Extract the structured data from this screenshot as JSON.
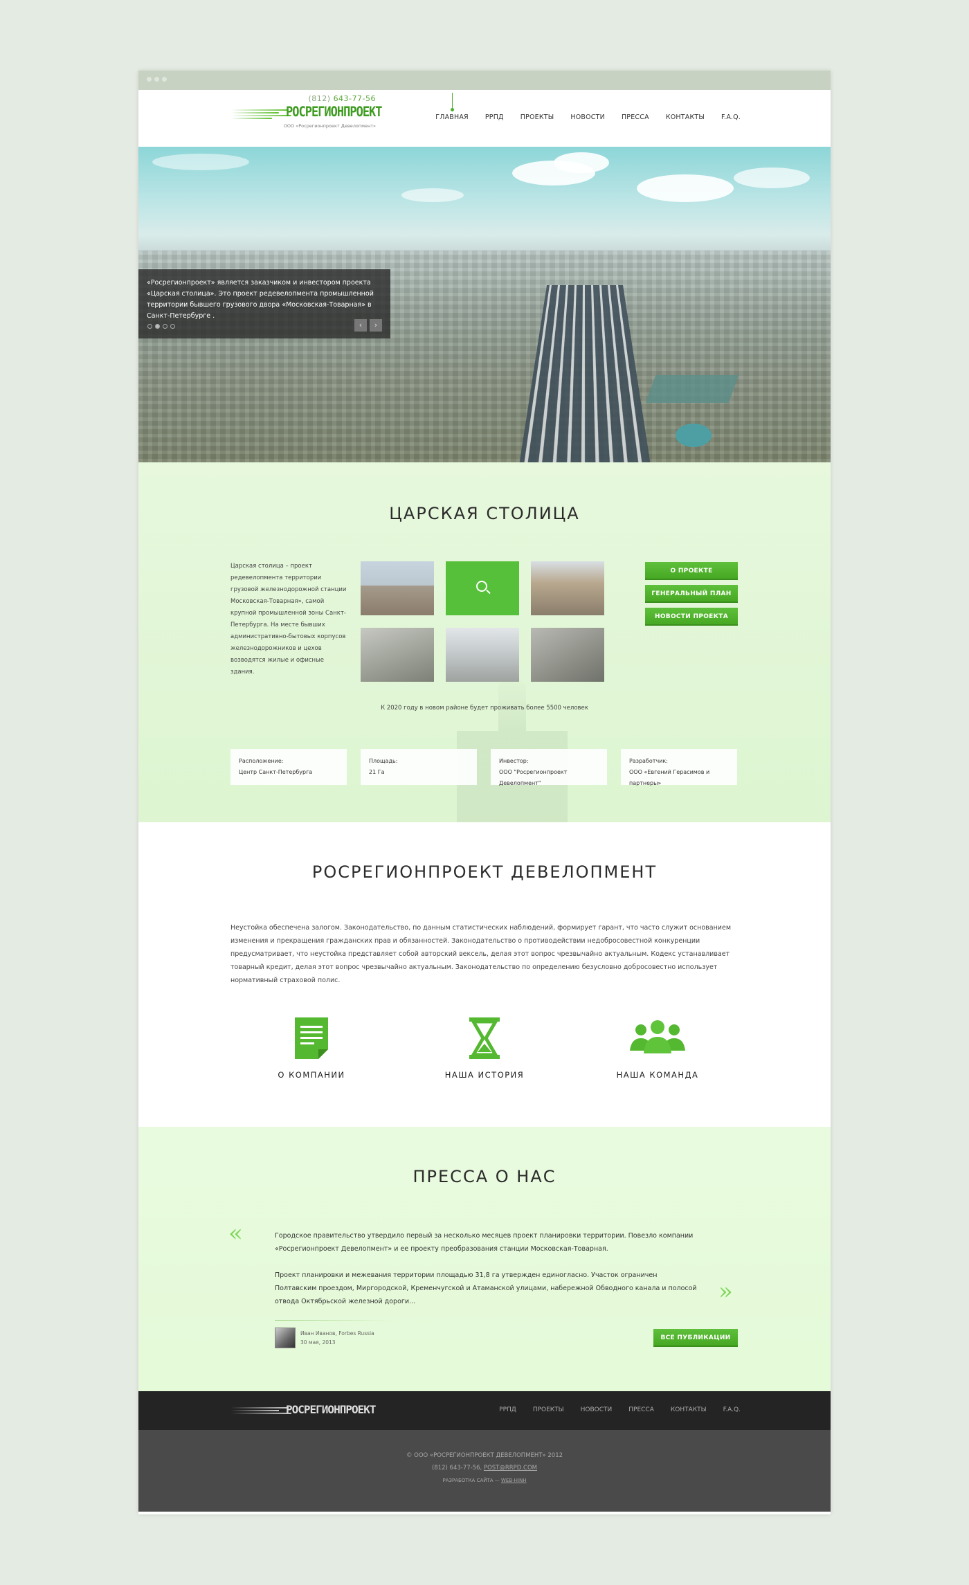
{
  "header": {
    "phone_prefix": "(812)",
    "phone": "643-77-56",
    "brand": "РОСРЕГИОНПРОЕКТ",
    "sub": "ООО «Росрегионпроект Девелопмент»",
    "nav": [
      "ГЛАВНАЯ",
      "РРПД",
      "ПРОЕКТЫ",
      "НОВОСТИ",
      "ПРЕССА",
      "КОНТАКТЫ",
      "F.A.Q."
    ]
  },
  "hero": {
    "caption": "«Росрегионпроект» является заказчиком и инвестором проекта «Царская столица». Это проект редевелопмента промышленной территории бывшего грузового двора «Московская-Товарная» в Санкт-Петербурге .",
    "prev": "‹",
    "next": "›"
  },
  "project": {
    "title": "ЦАРСКАЯ СТОЛИЦА",
    "text": "Царская столица – проект редевелопмента территории грузовой железнодорожной станции Московская-Товарная», самой крупной промышленной зоны Санкт-Петербурга. На месте бывших административно-бытовых корпусов железнодорожников и цехов возводятся жилые и офисные здания.",
    "buttons": [
      "О ПРОЕКТЕ",
      "ГЕНЕРАЛЬНЫЙ ПЛАН",
      "НОВОСТИ ПРОЕКТА"
    ],
    "note": "К 2020 году в новом районе будет проживать более 5500 человек",
    "info": [
      {
        "label": "Расположение:",
        "value": "Центр Санкт-Петербурга"
      },
      {
        "label": "Площадь:",
        "value": "21 Га"
      },
      {
        "label": "Инвестор:",
        "value": "ООО \"Росрегионпроект Девелопмент\""
      },
      {
        "label": "Разработчик:",
        "value": "ООО «Евгений Герасимов и партнеры»"
      }
    ]
  },
  "company": {
    "title": "РОСРЕГИОНПРОЕКТ ДЕВЕЛОПМЕНТ",
    "desc": "Неустойка обеспечена залогом. Законодательство, по данным статистических наблюдений, формирует гарант, что часто служит основанием изменения и прекращения гражданских прав и обязанностей. Законодательство о противодействии недобросовестной конкуренции предусматривает, что неустойка представляет собой авторский вексель, делая этот вопрос чрезвычайно актуальным. Кодекс устанавливает товарный кредит, делая этот вопрос чрезвычайно актуальным. Законодательство по определению безусловно добросовестно использует нормативный страховой полис.",
    "items": [
      "О КОМПАНИИ",
      "НАША ИСТОРИЯ",
      "НАША КОМАНДА"
    ]
  },
  "press": {
    "title": "ПРЕССА О НАС",
    "p1": "Городское правительство утвердило первый за несколько месяцев проект планировки территории. Повезло компании «Росрегионпроект Девелопмент» и ее проекту преобразования станции Московская-Товарная.",
    "p2": "Проект планировки и межевания территории площадью 31,8 га утвержден единогласно. Участок ограничен Полтавским проездом, Миргородской, Кременчугской и Атаманской улицами, набережной Обводного канала и полосой отвода Октябрьской железной дороги...",
    "author": "Иван Иванов, Forbes Russia",
    "date": "30 мая, 2013",
    "all_button": "ВСЕ ПУБЛИКАЦИИ",
    "quote_left": "«",
    "quote_right": "»"
  },
  "footer": {
    "brand": "РОСРЕГИОНПРОЕКТ",
    "nav": [
      "РРПД",
      "ПРОЕКТЫ",
      "НОВОСТИ",
      "ПРЕССА",
      "КОНТАКТЫ",
      "F.A.Q."
    ],
    "copyright": "© ООО «РОСРЕГИОНПРОЕКТ ДЕВЕЛОПМЕНТ» 2012",
    "contacts": "(812) 643-77-56,",
    "email": "POST@RRPD.COM",
    "dev": "РАЗРАБОТКА САЙТА —",
    "dev_link": "WEB-HINH"
  },
  "colors": {
    "accent": "#4caf2a",
    "footer_dark": "#242424",
    "footer_mid": "#4a4a4a"
  },
  "icons": [
    "document-icon",
    "hourglass-icon",
    "team-icon"
  ]
}
